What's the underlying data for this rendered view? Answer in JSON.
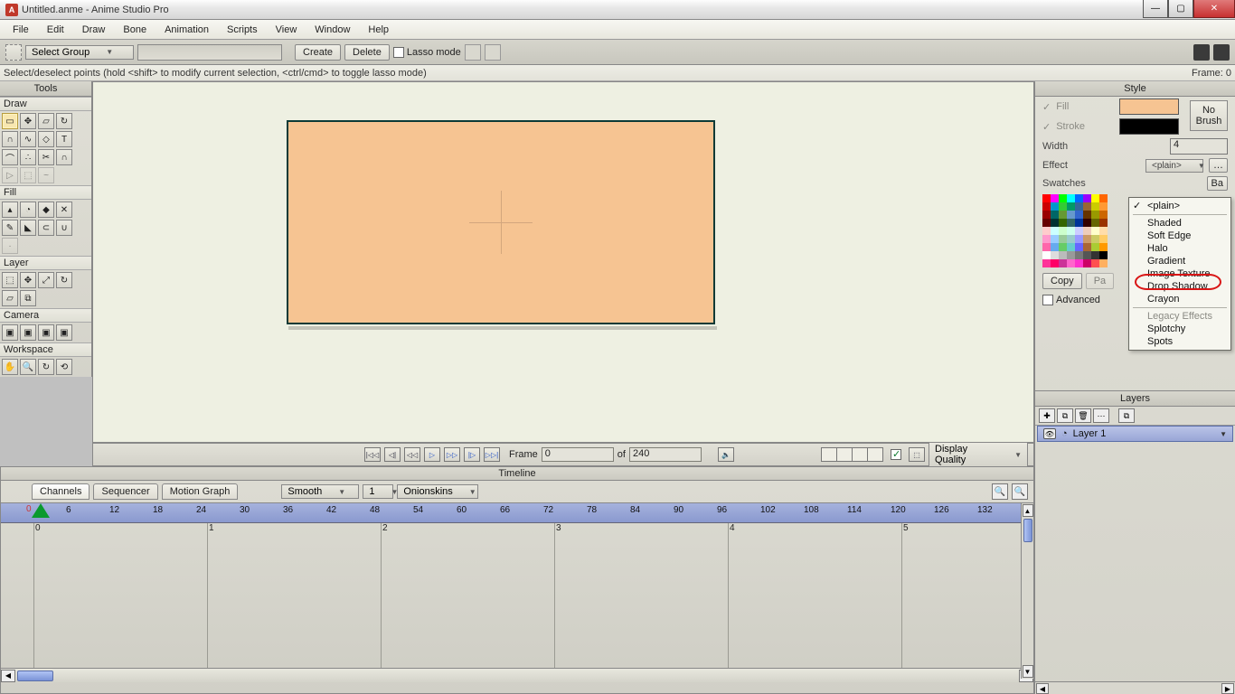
{
  "window": {
    "title": "Untitled.anme - Anime Studio Pro"
  },
  "menu": [
    "File",
    "Edit",
    "Draw",
    "Bone",
    "Animation",
    "Scripts",
    "View",
    "Window",
    "Help"
  ],
  "optbar": {
    "select_group": "Select Group",
    "create": "Create",
    "delete": "Delete",
    "lasso": "Lasso mode"
  },
  "hint": {
    "text": "Select/deselect points (hold <shift> to modify current selection, <ctrl/cmd> to toggle lasso mode)",
    "frame_label": "Frame: 0"
  },
  "tools": {
    "title": "Tools",
    "sections": {
      "draw": "Draw",
      "fill": "Fill",
      "layer": "Layer",
      "camera": "Camera",
      "workspace": "Workspace"
    }
  },
  "transport": {
    "frame_label": "Frame",
    "frame_value": "0",
    "of": "of",
    "total": "240",
    "quality": "Display Quality"
  },
  "timeline": {
    "title": "Timeline",
    "tabs": [
      "Channels",
      "Sequencer",
      "Motion Graph"
    ],
    "smooth": "Smooth",
    "one": "1",
    "onion": "Onionskins",
    "ruler_ticks": [
      6,
      12,
      18,
      24,
      30,
      36,
      42,
      48,
      54,
      60,
      66,
      72,
      78,
      84,
      90,
      96,
      102,
      108,
      114,
      120,
      126,
      132
    ],
    "seconds": [
      0,
      1,
      2,
      3,
      4,
      5
    ]
  },
  "style": {
    "title": "Style",
    "fill": "Fill",
    "stroke": "Stroke",
    "width_label": "Width",
    "width_value": "4",
    "effect": "Effect",
    "effect_value": "<plain>",
    "swatches": "Swatches",
    "basic": "Ba",
    "nobrush": "No Brush",
    "copy": "Copy",
    "paste": "Pa",
    "advanced": "Advanced"
  },
  "effect_menu": {
    "current": "<plain>",
    "items": [
      "Shaded",
      "Soft Edge",
      "Halo",
      "Gradient",
      "Image Texture",
      "Drop Shadow",
      "Crayon"
    ],
    "legacy_header": "Legacy Effects",
    "legacy_items": [
      "Splotchy",
      "Spots"
    ]
  },
  "layers": {
    "title": "Layers",
    "layer1": "Layer 1"
  },
  "swatch_colors": [
    "#ff0000",
    "#ff00ff",
    "#00ff00",
    "#00ffff",
    "#0066ff",
    "#9900ff",
    "#ffff00",
    "#ff6600",
    "#cc0000",
    "#0099cc",
    "#33cc33",
    "#009966",
    "#336699",
    "#996633",
    "#cccc00",
    "#ff9933",
    "#990000",
    "#006666",
    "#669933",
    "#6699cc",
    "#3366cc",
    "#663300",
    "#999900",
    "#cc6600",
    "#660000",
    "#003333",
    "#336600",
    "#336666",
    "#003399",
    "#330000",
    "#666600",
    "#993300",
    "#ffcccc",
    "#ccffff",
    "#ccffcc",
    "#ccffee",
    "#ccccff",
    "#eeccbb",
    "#ffffcc",
    "#ffddaa",
    "#ff99cc",
    "#99ccff",
    "#99cc99",
    "#99cccc",
    "#9999ff",
    "#cc9966",
    "#cccc66",
    "#ffcc66",
    "#ff66aa",
    "#66aaee",
    "#66cc66",
    "#66cccc",
    "#6666ff",
    "#aa6633",
    "#aacc33",
    "#ff9900",
    "#ffffff",
    "#dddddd",
    "#bbbbbb",
    "#999999",
    "#777777",
    "#555555",
    "#333333",
    "#000000",
    "#ff3399",
    "#ff0066",
    "#cc3399",
    "#ff66cc",
    "#ff33cc",
    "#cc0066",
    "#ff5050",
    "#ffb060"
  ]
}
